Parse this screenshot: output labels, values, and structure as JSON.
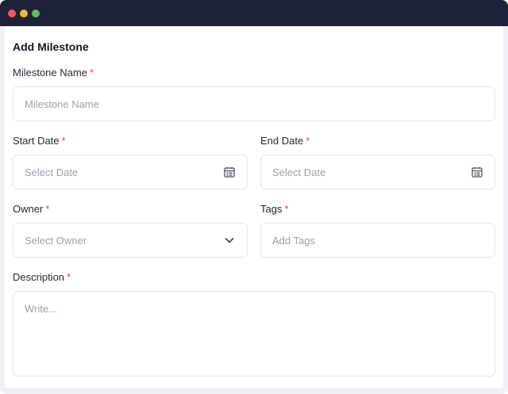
{
  "form": {
    "title": "Add Milestone",
    "milestone_name": {
      "label": "Milestone Name",
      "required": "*",
      "placeholder": "Milestone Name"
    },
    "start_date": {
      "label": "Start Date",
      "required": "*",
      "placeholder": "Select Date",
      "icon": "calendar-icon"
    },
    "end_date": {
      "label": "End Date",
      "required": "*",
      "placeholder": "Select Date",
      "icon": "calendar-icon"
    },
    "owner": {
      "label": "Owner",
      "required": "*",
      "placeholder": "Select Owner",
      "icon": "chevron-down-icon"
    },
    "tags": {
      "label": "Tags",
      "required": "*",
      "placeholder": "Add Tags"
    },
    "description": {
      "label": "Description",
      "required": "*",
      "placeholder": "Write..."
    }
  },
  "colors": {
    "titlebar": "#1d2238",
    "required": "#ef4444",
    "border": "#e3e6ec",
    "placeholder": "#9aa1ad"
  }
}
